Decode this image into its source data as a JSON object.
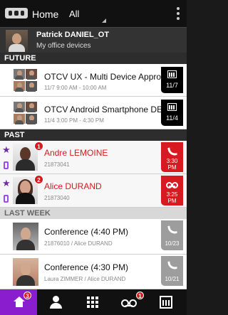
{
  "topbar": {
    "title": "Home",
    "filter": "All"
  },
  "user": {
    "name": "Patrick DANIEL_OT",
    "subtitle": "My office devices"
  },
  "sections": {
    "future": "FUTURE",
    "past": "PAST",
    "last_week": "LAST WEEK"
  },
  "future": [
    {
      "title": "OTCV UX - Multi Device Approa...",
      "subtitle": "11/7 9:00 AM - 10:00 AM",
      "date": "11/7",
      "icon": "calendar-icon"
    },
    {
      "title": "OTCV Android Smartphone DE...",
      "subtitle": "11/4 3:00 PM - 4:30 PM",
      "date": "11/4",
      "icon": "calendar-icon"
    }
  ],
  "past": [
    {
      "name": "Andre LEMOINE",
      "number": "21873041",
      "badge": "1",
      "time_line1": "3:30",
      "time_line2": "PM",
      "icon": "phone-icon",
      "status_color": "#d71920"
    },
    {
      "name": "Alice DURAND",
      "number": "21873040",
      "badge": "2",
      "time_line1": "3:25",
      "time_line2": "PM",
      "icon": "voicemail-icon",
      "status_color": "#d71920"
    }
  ],
  "last_week": [
    {
      "title": "Conference (4:40 PM)",
      "subtitle": "21876010 / Alice DURAND",
      "date": "10/23",
      "icon": "phone-icon"
    },
    {
      "title": "Conference (4:30 PM)",
      "subtitle": "Laura ZIMMER / Alice DURAND",
      "date": "10/21",
      "icon": "phone-icon"
    }
  ],
  "bottom_nav": [
    {
      "name": "home",
      "icon": "home-icon",
      "badge": "3"
    },
    {
      "name": "contacts",
      "icon": "user-icon",
      "badge": ""
    },
    {
      "name": "dialpad",
      "icon": "grid-icon",
      "badge": ""
    },
    {
      "name": "voicemail",
      "icon": "voicemail-icon",
      "badge": "1"
    },
    {
      "name": "calendar",
      "icon": "calendar-icon",
      "badge": ""
    }
  ],
  "colors": {
    "accent": "#8a1ecf",
    "alert": "#d71920",
    "future_box": "#000000",
    "past_box": "#d71920",
    "history_box": "#9d9d9d"
  }
}
